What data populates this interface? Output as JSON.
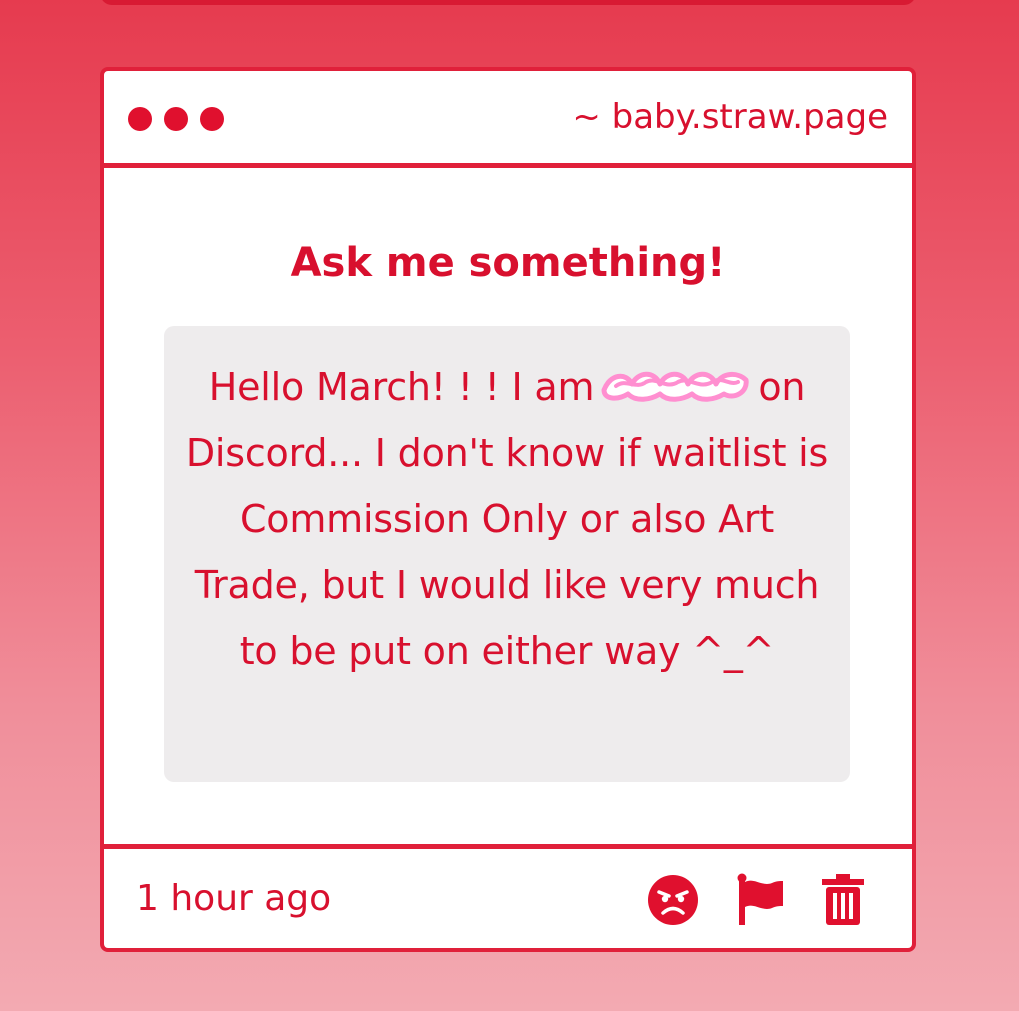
{
  "header": {
    "site_label": "~ baby.straw.page"
  },
  "main": {
    "title": "Ask me something!",
    "message": {
      "before_redaction": "Hello March! ! ! I am",
      "after_redaction": "on Discord... I don't know if waitlist is Commission Only or also Art Trade, but I would like very much to be put on either way ^_^"
    }
  },
  "footer": {
    "timestamp": "1 hour ago",
    "actions": [
      {
        "icon": "angry-face-icon"
      },
      {
        "icon": "flag-icon"
      },
      {
        "icon": "trash-icon"
      }
    ]
  },
  "colors": {
    "accent": "#e0102e",
    "redaction": "#ff8fd0",
    "message_background": "#eeeced"
  }
}
